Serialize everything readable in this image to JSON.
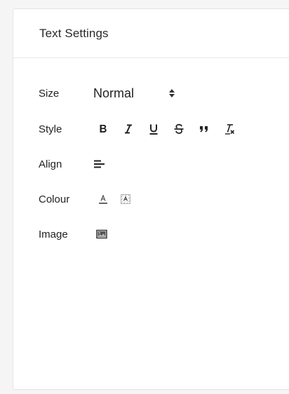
{
  "panel": {
    "title": "Text Settings"
  },
  "rows": {
    "size": {
      "label": "Size",
      "value": "Normal"
    },
    "style": {
      "label": "Style"
    },
    "align": {
      "label": "Align"
    },
    "colour": {
      "label": "Colour"
    },
    "image": {
      "label": "Image"
    }
  },
  "style_buttons": [
    "bold-icon",
    "italic-icon",
    "underline-icon",
    "strikethrough-icon",
    "blockquote-icon",
    "clear-format-icon"
  ],
  "colors": {
    "text": "#222222",
    "border": "#e4e4e4",
    "background": "#f5f5f5"
  }
}
